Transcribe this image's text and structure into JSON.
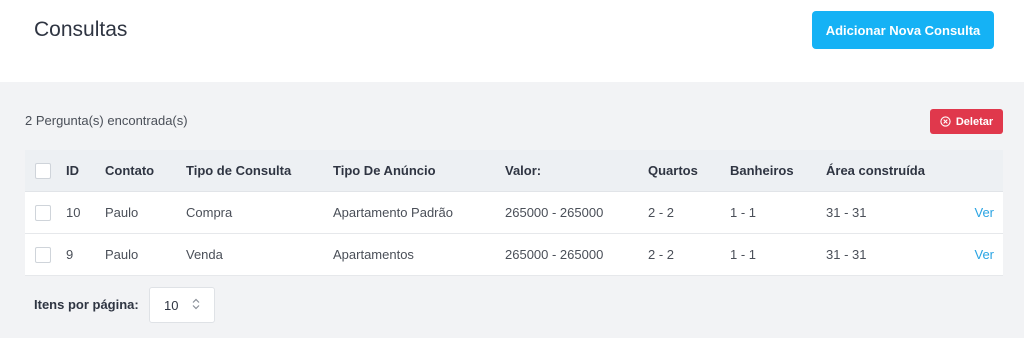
{
  "header": {
    "title": "Consultas",
    "add_button_label": "Adicionar Nova Consulta"
  },
  "toolbar": {
    "results_count": "2 Pergunta(s) encontrada(s)",
    "delete_label": "Deletar"
  },
  "table": {
    "columns": [
      "ID",
      "Contato",
      "Tipo de Consulta",
      "Tipo De Anúncio",
      "Valor:",
      "Quartos",
      "Banheiros",
      "Área construída"
    ],
    "rows": [
      {
        "id": "10",
        "contato": "Paulo",
        "tipo_consulta": "Compra",
        "tipo_anuncio": "Apartamento Padrão",
        "valor": "265000 - 265000",
        "quartos": "2 - 2",
        "banheiros": "1 - 1",
        "area": "31 - 31",
        "action": "Ver"
      },
      {
        "id": "9",
        "contato": "Paulo",
        "tipo_consulta": "Venda",
        "tipo_anuncio": "Apartamentos",
        "valor": "265000 - 265000",
        "quartos": "2 - 2",
        "banheiros": "1 - 1",
        "area": "31 - 31",
        "action": "Ver"
      }
    ]
  },
  "pagination": {
    "items_per_page_label": "Itens por página:",
    "items_per_page_value": "10"
  },
  "colors": {
    "primary": "#15b2f5",
    "danger": "#e0384c",
    "link": "#2aa4e3"
  },
  "icons": {
    "delete": "circle-x-icon",
    "select": "chevron-updown-icon"
  }
}
